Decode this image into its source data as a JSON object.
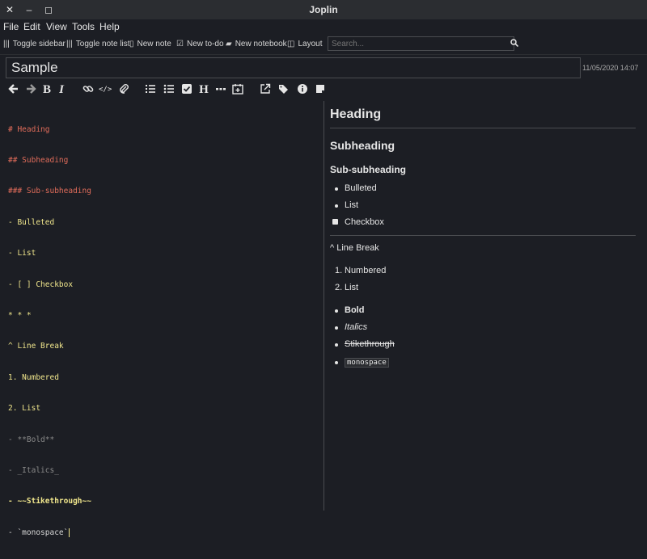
{
  "window": {
    "title": "Joplin",
    "buttons": [
      "✕",
      "–",
      "◻"
    ]
  },
  "menu": [
    "File",
    "Edit",
    "View",
    "Tools",
    "Help"
  ],
  "toolbar": {
    "toggle_sidebar": "Toggle sidebar",
    "toggle_note_list": "Toggle note list",
    "new_note": "New note",
    "new_todo": "New to-do",
    "new_notebook": "New notebook",
    "layout": "Layout",
    "search_placeholder": "Search..."
  },
  "note": {
    "title": "Sample",
    "date": "11/05/2020 14:07"
  },
  "format_toolbar": {
    "icons": [
      "back-icon",
      "forward-icon",
      "bold-icon",
      "italic-icon",
      "link-icon",
      "code-icon",
      "attach-icon",
      "numbered-list-icon",
      "bulleted-list-icon",
      "checkbox-icon",
      "heading-icon",
      "horizontal-rule-icon",
      "insert-date-icon",
      "external-editor-icon",
      "tags-icon",
      "info-icon",
      "note-properties-icon"
    ],
    "glyphs": {
      "bold": "B",
      "italic": "I",
      "heading": "H"
    }
  },
  "editor": {
    "lines": [
      "# Heading",
      "## Subheading",
      "### Sub-subheading",
      "- Bulleted",
      "- List",
      "- [ ] Checkbox",
      "* * *",
      "^ Line Break",
      "1. Numbered",
      "2. List",
      "- **Bold**",
      "- _Italics_",
      "- ~~Stikethrough~~",
      "- `monospace`"
    ]
  },
  "viewer": {
    "h1": "Heading",
    "h2": "Subheading",
    "h3": "Sub-subheading",
    "bullets": [
      "Bulleted",
      "List"
    ],
    "checkbox": "Checkbox",
    "line_break": "^ Line Break",
    "numbered": [
      "Numbered",
      "List"
    ],
    "numbers": [
      "1.",
      "2."
    ],
    "bold": "Bold",
    "italics": "Italics",
    "strike": "Stikethrough",
    "monospace": "monospace"
  },
  "colors": {
    "background": "#1c1e24",
    "heading_markdown": "#e06c5a",
    "text_markdown": "#f0e68c",
    "divider": "#4a4c50"
  }
}
